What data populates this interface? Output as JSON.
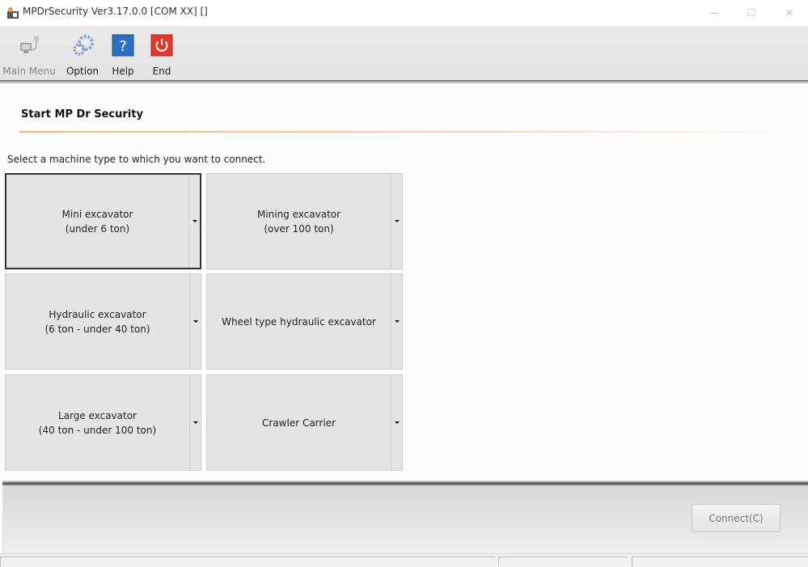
{
  "window": {
    "title": "MPDrSecurity Ver3.17.0.0 [COM XX] []",
    "minimize_glyph": "—",
    "maximize_glyph": "☐",
    "close_glyph": "✕"
  },
  "toolbar": {
    "items": [
      {
        "label": "Main Menu",
        "icon": "computer-cable-icon",
        "enabled": false
      },
      {
        "label": "Option",
        "icon": "gears-icon",
        "enabled": true
      },
      {
        "label": "Help",
        "icon": "help-icon",
        "enabled": true
      },
      {
        "label": "End",
        "icon": "power-icon",
        "enabled": true
      }
    ]
  },
  "main": {
    "page_title": "Start MP Dr Security",
    "instructions": "Select a machine type to which you want to connect.",
    "machine_types": [
      {
        "label": "Mini excavator\n(under 6 ton)",
        "selected": true
      },
      {
        "label": "Mining excavator\n(over 100 ton)",
        "selected": false
      },
      {
        "label": "Hydraulic excavator\n(6 ton - under 40 ton)",
        "selected": false
      },
      {
        "label": "Wheel type hydraulic excavator",
        "selected": false
      },
      {
        "label": "Large excavator\n(40 ton - under 100 ton)",
        "selected": false
      },
      {
        "label": "Crawler Carrier",
        "selected": false
      }
    ]
  },
  "footer": {
    "connect_label": "Connect(C)",
    "connect_enabled": false
  },
  "colors": {
    "accent_rule": "#f4b27e",
    "help_blue": "#2f6fc0",
    "end_red": "#e0392b"
  }
}
